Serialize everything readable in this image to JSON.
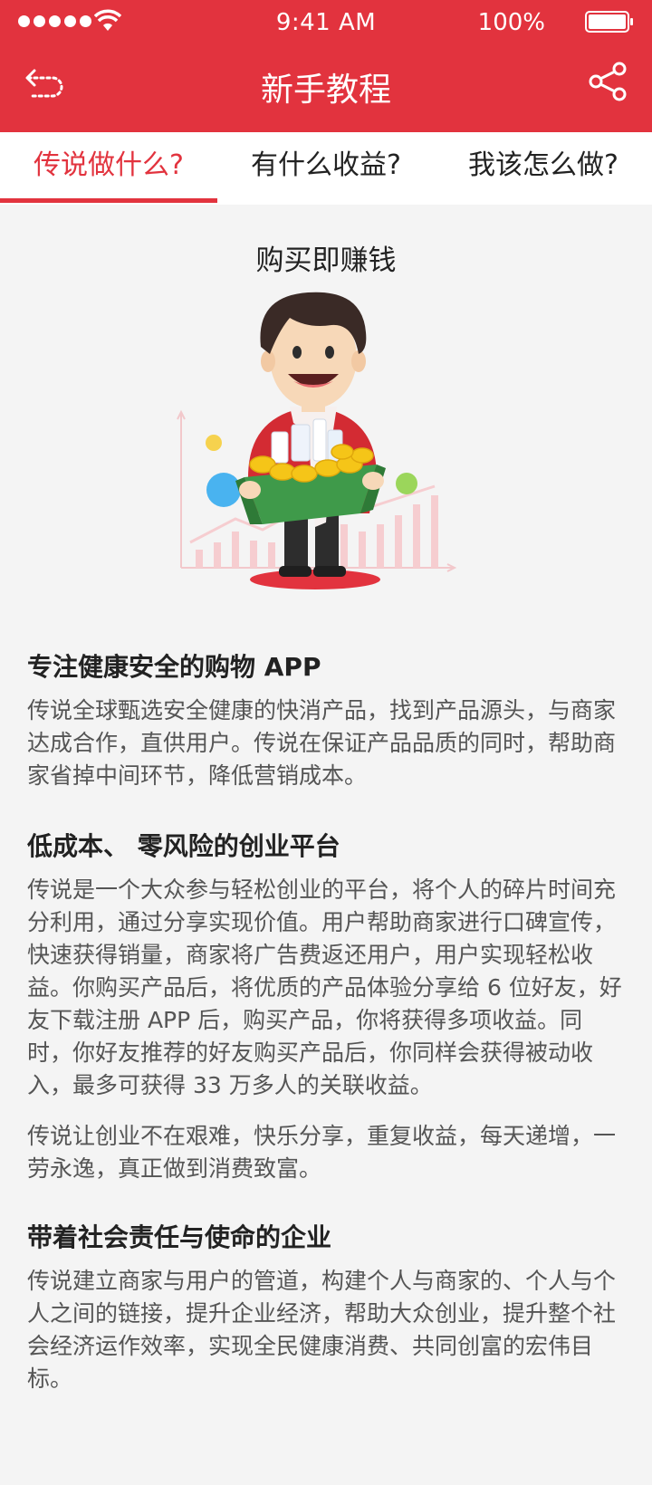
{
  "status_bar": {
    "time": "9:41 AM",
    "battery": "100%"
  },
  "header": {
    "title": "新手教程",
    "back_icon": "back-arrow-icon",
    "share_icon": "share-icon"
  },
  "tabs": [
    {
      "label": "传说做什么?",
      "active": true
    },
    {
      "label": "有什么收益?",
      "active": false
    },
    {
      "label": "我该怎么做?",
      "active": false
    }
  ],
  "hero": {
    "title": "购买即赚钱",
    "illustration": "man-holding-box-of-coins-illustration"
  },
  "sections": [
    {
      "title": "专注健康安全的购物 APP",
      "paragraphs": [
        "传说全球甄选安全健康的快消产品，找到产品源头，与商家达成合作，直供用户。传说在保证产品品质的同时，帮助商家省掉中间环节，降低营销成本。"
      ]
    },
    {
      "title": "低成本、 零风险的创业平台",
      "paragraphs": [
        "传说是一个大众参与轻松创业的平台，将个人的碎片时间充分利用，通过分享实现价值。用户帮助商家进行口碑宣传，快速获得销量，商家将广告费返还用户，用户实现轻松收益。你购买产品后，将优质的产品体验分享给 6 位好友，好友下载注册 APP 后，购买产品，你将获得多项收益。同时，你好友推荐的好友购买产品后，你同样会获得被动收入，最多可获得 33 万多人的关联收益。",
        "传说让创业不在艰难，快乐分享，重复收益，每天递增，一劳永逸，真正做到消费致富。"
      ]
    },
    {
      "title": "带着社会责任与使命的企业",
      "paragraphs": [
        "传说建立商家与用户的管道，构建个人与商家的、个人与个人之间的链接，提升企业经济，帮助大众创业，提升整个社会经济运作效率，实现全民健康消费、共同创富的宏伟目标。"
      ]
    }
  ],
  "colors": {
    "brand_red": "#e2333e",
    "background": "#f4f4f4"
  }
}
